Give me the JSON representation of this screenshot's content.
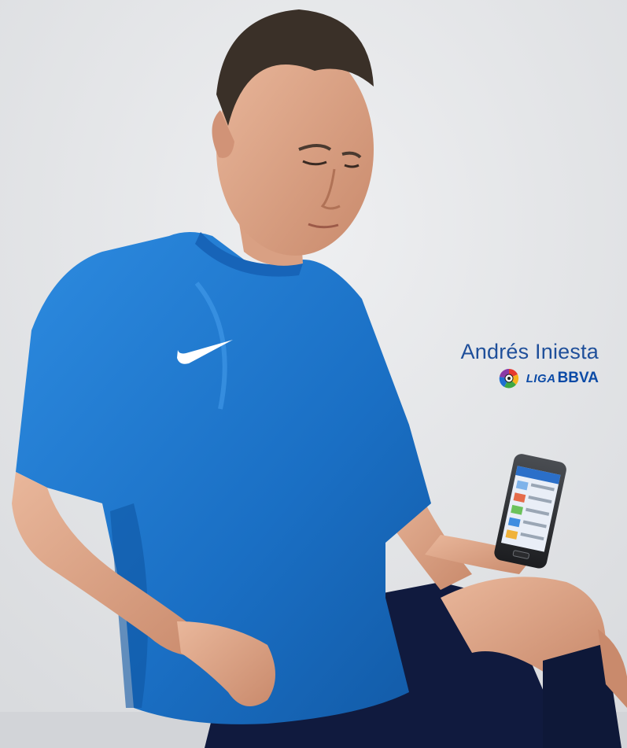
{
  "caption": {
    "player_name": "Andrés Iniesta",
    "league_prefix": "LIGA",
    "league_suffix": "BBVA"
  },
  "colors": {
    "background": "#e4e5e7",
    "jersey": "#1a72c8",
    "shorts": "#101a3e",
    "name_text": "#1f4f9a",
    "league_text": "#0b4aa6"
  },
  "icons": [
    "nike-swoosh-icon",
    "liga-bbva-logo",
    "smartphone"
  ]
}
